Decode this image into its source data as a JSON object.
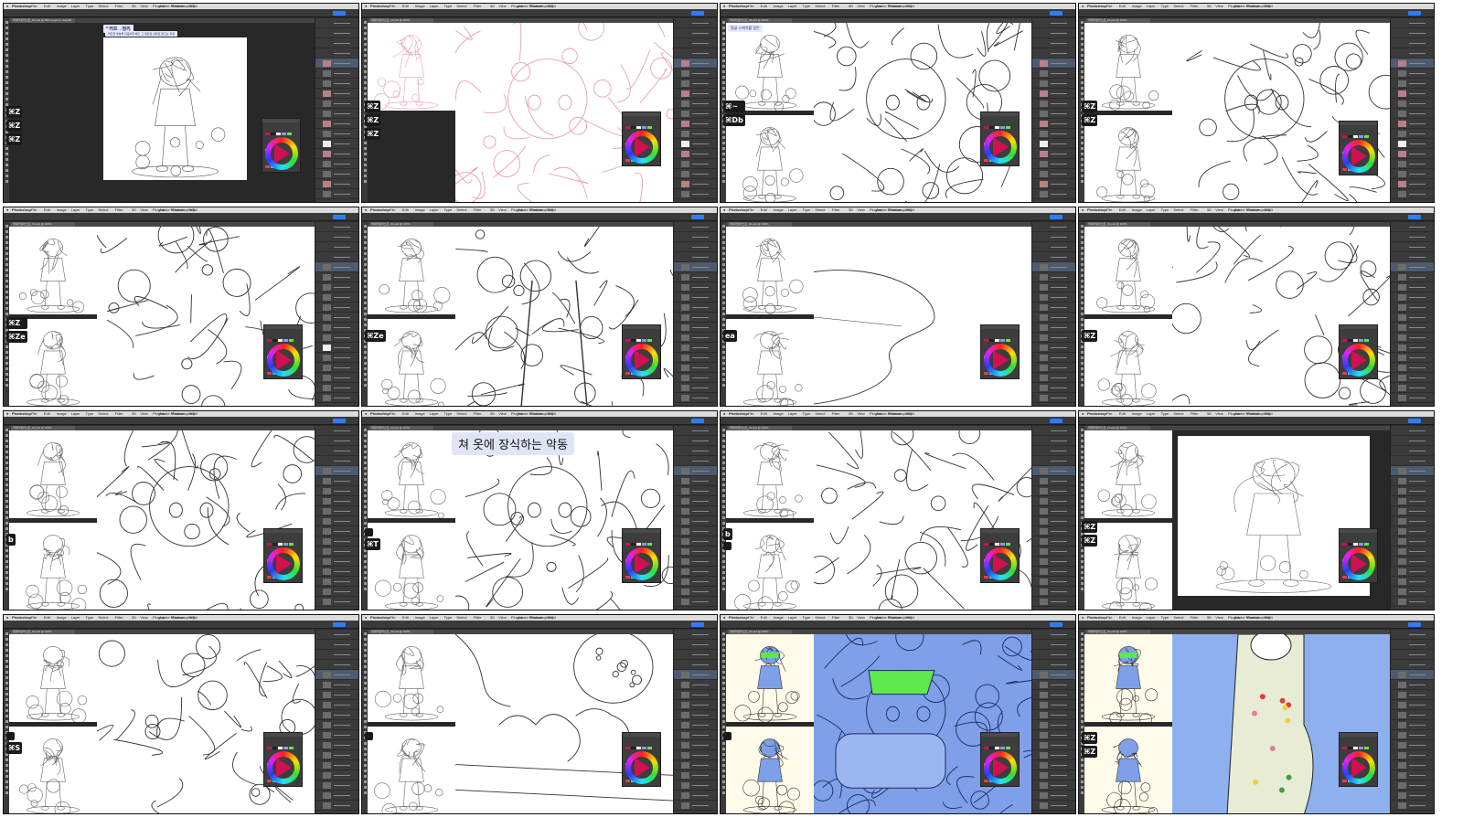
{
  "menu": {
    "app": "Photoshop",
    "items": [
      "File",
      "Edit",
      "Image",
      "Layer",
      "Type",
      "Select",
      "Filter",
      "3D",
      "View",
      "Plugins",
      "Window",
      "Help"
    ],
    "title": "Adobe Photoshop 2024"
  },
  "tiles": [
    {
      "id": "t01",
      "doc_tab": "캐릭터일러스트_01.psd @ 50% (Layer 1, Gray/8)",
      "note": "* 러프→정리",
      "note_line": "러프한 부분을 다듬어주세요. 그 정돈된 선화로 만드는 과정",
      "keys": [
        "⌘Z",
        "⌘Z",
        "⌘Z"
      ]
    },
    {
      "id": "t02",
      "doc_tab": "캐릭터일러스트_01.psd @ 100%",
      "note": "",
      "note_line": "",
      "keys": [
        "⌘Z",
        "⌘Z",
        "⌘Z"
      ]
    },
    {
      "id": "t03",
      "doc_tab": "캐릭터일러스트_01.psd @ 100%",
      "note": "얼굴 스케치를 정돈",
      "note_line": "",
      "keys": [
        "⌘~",
        "⌘Db"
      ]
    },
    {
      "id": "t04",
      "doc_tab": "캐릭터일러스트_01.psd @ 100%",
      "note": "",
      "note_line": "",
      "keys": [
        "⌘Z",
        "⌘Z"
      ]
    },
    {
      "id": "t05",
      "doc_tab": "캐릭터일러스트_01.psd @ 100%",
      "note": "",
      "note_line": "",
      "keys": [
        "⌘Z",
        "⌘Ze"
      ]
    },
    {
      "id": "t06",
      "doc_tab": "캐릭터일러스트_01.psd @ 100%",
      "note": "",
      "note_line": "",
      "keys": [
        "⌘Ze"
      ]
    },
    {
      "id": "t07",
      "doc_tab": "캐릭터일러스트_01.psd @ 100%",
      "note": "",
      "note_line": "",
      "keys": [
        "ea"
      ]
    },
    {
      "id": "t08",
      "doc_tab": "캐릭터일러스트_01.psd @ 100%",
      "note": "",
      "note_line": "",
      "keys": [
        "⌘Z"
      ]
    },
    {
      "id": "t09",
      "doc_tab": "캐릭터일러스트_01.psd @ 100%",
      "note": "",
      "note_line": "",
      "keys": [
        "b"
      ]
    },
    {
      "id": "t10",
      "doc_tab": "캐릭터일러스트_01.psd @ 100%",
      "note": "",
      "note_line": "",
      "keys": [
        "",
        "⌘T"
      ],
      "bignote": "쳐 옷에 장식하는 악동"
    },
    {
      "id": "t11",
      "doc_tab": "캐릭터일러스트_01.psd @ 100%",
      "note": "",
      "note_line": "",
      "keys": [
        "b",
        ""
      ]
    },
    {
      "id": "t12",
      "doc_tab": "캐릭터일러스트_01.psd @ 100%",
      "note": "",
      "note_line": "",
      "keys": [
        "⌘Z",
        "⌘Z"
      ]
    },
    {
      "id": "t13",
      "doc_tab": "캐릭터일러스트_01.psd @ 100%",
      "note": "",
      "note_line": "",
      "keys": [
        "",
        "⌘S"
      ]
    },
    {
      "id": "t14",
      "doc_tab": "캐릭터일러스트_01.psd @ 100%",
      "note": "",
      "note_line": "",
      "keys": [
        ""
      ]
    },
    {
      "id": "t15",
      "doc_tab": "캐릭터일러스트_01.psd @ 100%",
      "note": "",
      "note_line": "",
      "keys": [
        ""
      ]
    },
    {
      "id": "t16",
      "doc_tab": "캐릭터일러스트_01.psd @ 100%",
      "note": "",
      "note_line": "",
      "keys": [
        "⌘Z",
        "⌘Z"
      ]
    }
  ],
  "colors": {
    "blue_fill": "#7f9fe8",
    "green_goggles": "#5ee84b",
    "share_button": "#2f7df6",
    "swatch_pink": "#d01050"
  },
  "icons": [
    "apple-icon",
    "tool-icon",
    "layer-thumbnail-icon",
    "color-wheel-icon"
  ]
}
